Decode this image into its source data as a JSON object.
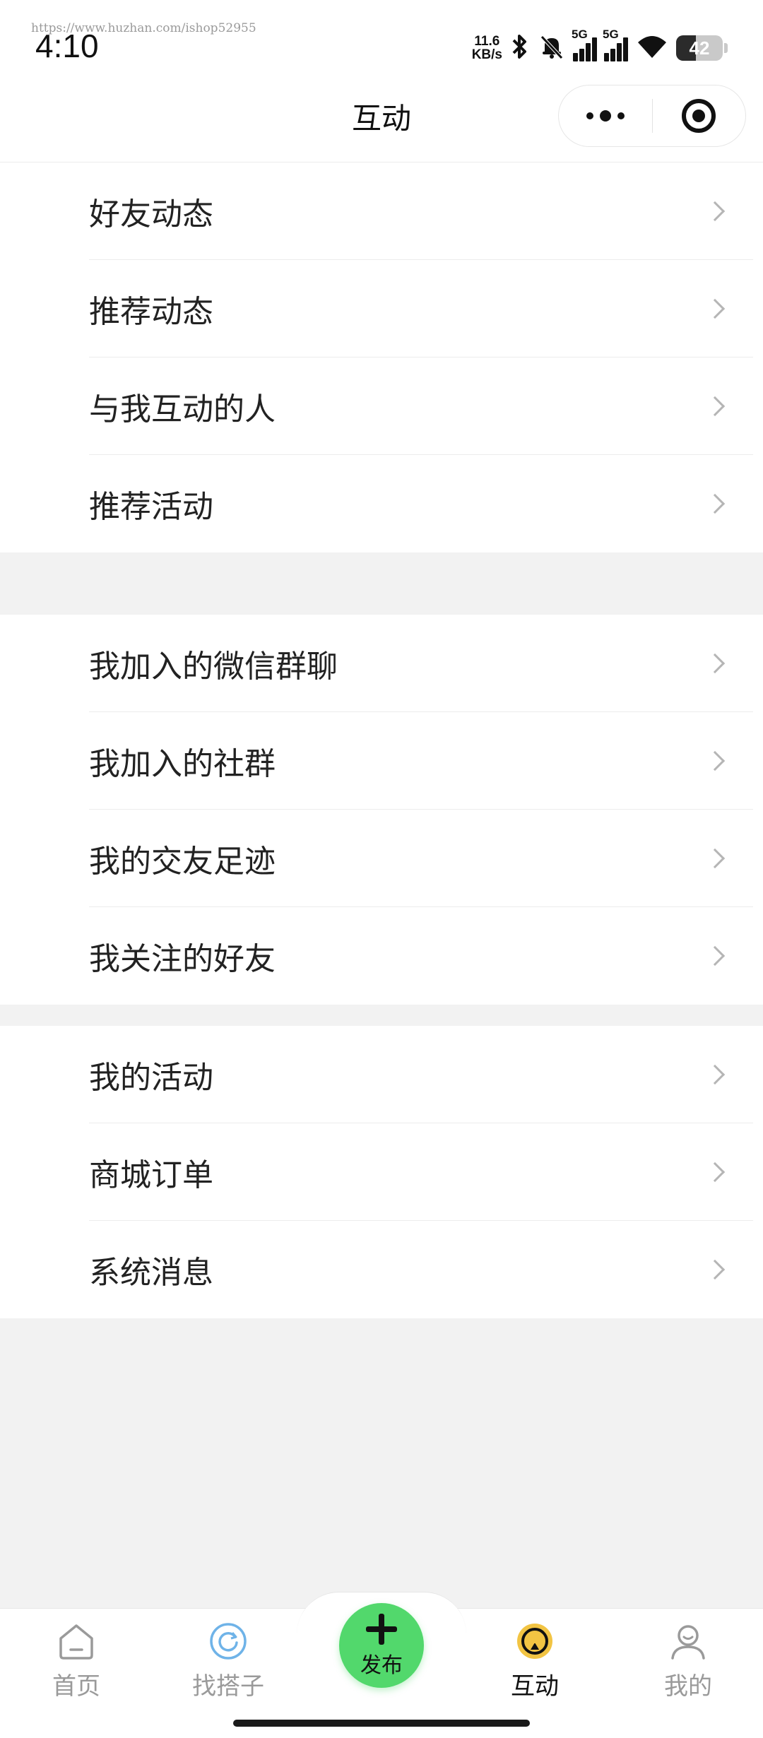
{
  "status_bar": {
    "watermark": "https://www.huzhan.com/ishop52955",
    "time": "4:10",
    "net_speed_value": "11.6",
    "net_speed_unit": "KB/s",
    "signal1_label": "5G",
    "signal2_label": "5G",
    "battery_level": "42"
  },
  "nav": {
    "title": "互动"
  },
  "groups": [
    {
      "items": [
        "好友动态",
        "推荐动态",
        "与我互动的人",
        "推荐活动"
      ]
    },
    {
      "items": [
        "我加入的微信群聊",
        "我加入的社群",
        "我的交友足迹",
        "我关注的好友"
      ]
    },
    {
      "items": [
        "我的活动",
        "商城订单",
        "系统消息"
      ]
    }
  ],
  "tab_bar": {
    "home": "首页",
    "find": "找搭子",
    "publish": "发布",
    "interact": "互动",
    "mine": "我的",
    "active_tab": "互动",
    "accent_color": "#52d86c"
  }
}
